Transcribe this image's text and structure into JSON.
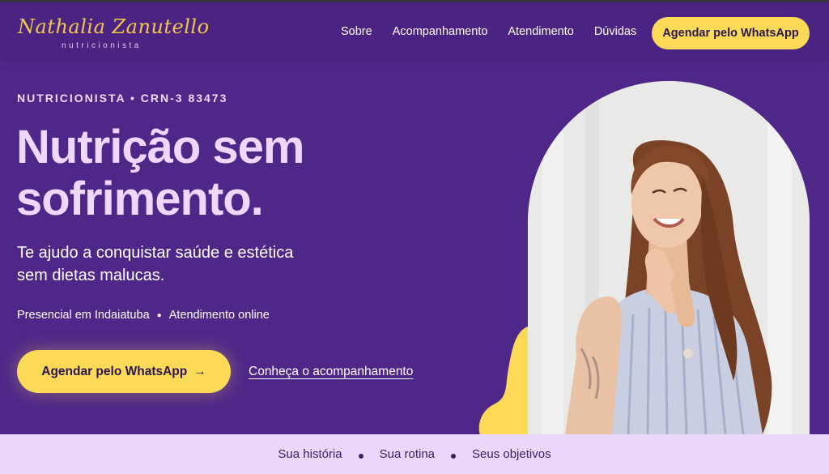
{
  "brand": {
    "name": "Nathalia Zanutello",
    "tagline": "nutricionista"
  },
  "nav": {
    "items": [
      {
        "label": "Sobre"
      },
      {
        "label": "Acompanhamento"
      },
      {
        "label": "Atendimento"
      },
      {
        "label": "Dúvidas"
      }
    ],
    "cta_label": "Agendar pelo WhatsApp"
  },
  "hero": {
    "eyebrow": "NUTRICIONISTA • CRN-3 83473",
    "headline_line1": "Nutrição sem",
    "headline_line2": "sofrimento.",
    "subhead_line1": "Te ajudo a conquistar saúde e estética",
    "subhead_line2": "sem dietas malucas.",
    "meta_1": "Presencial em Indaiatuba",
    "meta_2": "Atendimento online",
    "cta_label": "Agendar pelo WhatsApp",
    "cta_arrow": "→",
    "link_label": "Conheça o acompanhamento"
  },
  "bottom_bar": {
    "items": [
      {
        "label": "Sua história"
      },
      {
        "label": "Sua rotina"
      },
      {
        "label": "Seus objetivos"
      }
    ]
  },
  "colors": {
    "background": "#4f2789",
    "accent_yellow": "#fcd957",
    "headline_lilac": "#efd8ff",
    "bottom_bar": "#ead7fb"
  }
}
